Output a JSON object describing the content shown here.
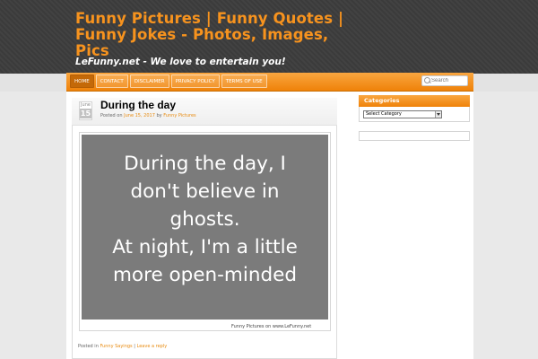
{
  "site": {
    "title": "Funny Pictures | Funny Quotes | Funny Jokes - Photos, Images, Pics",
    "tagline": "LeFunny.net - We love to entertain you!"
  },
  "nav": {
    "items": [
      {
        "label": "Home"
      },
      {
        "label": "Contact"
      },
      {
        "label": "Disclaimer"
      },
      {
        "label": "Privacy Policy"
      },
      {
        "label": "Terms of use"
      }
    ],
    "search_placeholder": "Search"
  },
  "post": {
    "date_month": "June",
    "date_day": "15",
    "title": "During the day",
    "meta_prefix": "Posted on",
    "meta_date": "June 15, 2017",
    "meta_by": "by",
    "meta_author": "Funny Pictures",
    "image_quote_lines": [
      "During the day, I",
      "don't believe in",
      "ghosts.",
      "At night, I'm a little",
      "more open-minded"
    ],
    "image_caption": "Funny Pictures on  www.LeFunny.net",
    "footer_prefix": "Posted in",
    "footer_category": "Funny Sayings",
    "footer_sep": "|",
    "footer_reply": "Leave a reply"
  },
  "sidebar": {
    "categories_title": "Categories",
    "categories_select": "Select Category"
  },
  "colors": {
    "accent": "#f7931e",
    "header_bg": "#3b3b3b",
    "image_bg": "#7b7b7b"
  }
}
